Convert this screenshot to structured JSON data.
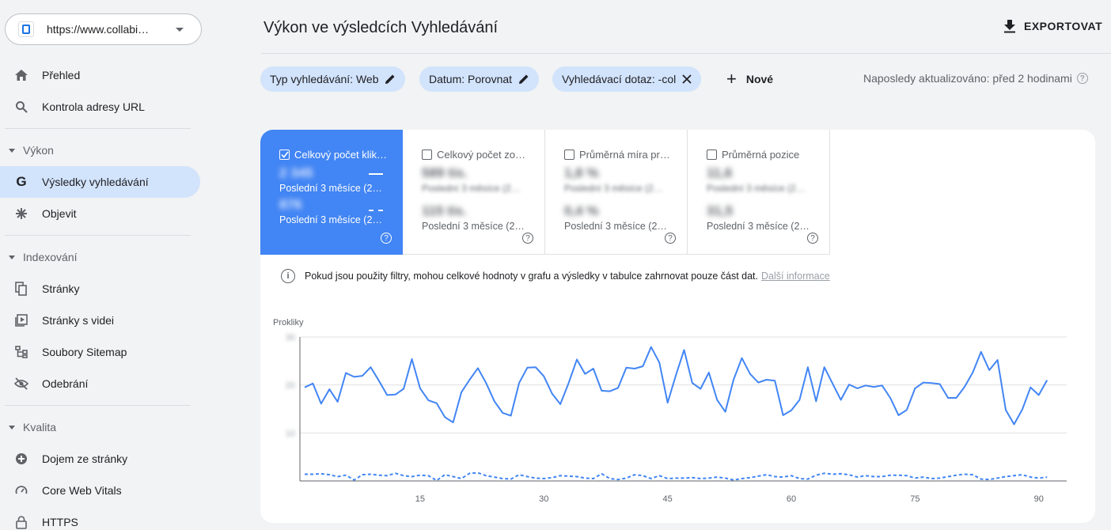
{
  "sidebar": {
    "property_url": "https://www.collabi…",
    "items_top": [
      {
        "label": "Přehled",
        "icon": "home-icon"
      },
      {
        "label": "Kontrola adresy URL",
        "icon": "search-icon"
      }
    ],
    "sections": [
      {
        "title": "Výkon",
        "items": [
          {
            "label": "Výsledky vyhledávání",
            "icon": "google-g-icon",
            "active": true
          },
          {
            "label": "Objevit",
            "icon": "asterisk-icon"
          }
        ]
      },
      {
        "title": "Indexování",
        "items": [
          {
            "label": "Stránky",
            "icon": "pages-icon"
          },
          {
            "label": "Stránky s videi",
            "icon": "video-pages-icon"
          },
          {
            "label": "Soubory Sitemap",
            "icon": "sitemap-icon"
          },
          {
            "label": "Odebrání",
            "icon": "eye-off-icon"
          }
        ]
      },
      {
        "title": "Kvalita",
        "items": [
          {
            "label": "Dojem ze stránky",
            "icon": "plus-circle-icon"
          },
          {
            "label": "Core Web Vitals",
            "icon": "gauge-icon"
          },
          {
            "label": "HTTPS",
            "icon": "lock-icon"
          }
        ]
      }
    ]
  },
  "header": {
    "title": "Výkon ve výsledcích Vyhledávání",
    "export_label": "EXPORTOVAT"
  },
  "filters": {
    "chips": [
      {
        "label": "Typ vyhledávání: Web",
        "icon": "pencil-icon"
      },
      {
        "label": "Datum: Porovnat",
        "icon": "pencil-icon"
      },
      {
        "label": "Vyhledávací dotaz: -col",
        "icon": "close-icon"
      }
    ],
    "new_label": "Nové",
    "updated_text": "Naposledy aktualizováno: před 2 hodinami"
  },
  "metrics": [
    {
      "label": "Celkový počet klik…",
      "checked": true,
      "value1": "2 345",
      "sub1": "",
      "period1": "Poslední 3 měsíce (2…",
      "value2": "876",
      "sub2": "",
      "period2": "Poslední 3 měsíce (2…"
    },
    {
      "label": "Celkový počet zo…",
      "checked": false,
      "value1": "589 tis.",
      "sub1": "Poslední 3 měsíce (2…",
      "value2": "115 tis.",
      "sub2": "",
      "period2": "Poslední 3 měsíce (2…"
    },
    {
      "label": "Průměrná míra pr…",
      "checked": false,
      "value1": "1,8 %",
      "sub1": "Poslední 3 měsíce (2…",
      "value2": "0,4 %",
      "sub2": "",
      "period2": "Poslední 3 měsíce (2…"
    },
    {
      "label": "Průměrná pozice",
      "checked": false,
      "value1": "11,6",
      "sub1": "Poslední 3 měsíce (2…",
      "value2": "31,5",
      "sub2": "",
      "period2": "Poslední 3 měsíce (2…"
    }
  ],
  "info": {
    "text": "Pokud jsou použity filtry, mohou celkové hodnoty v grafu a výsledky v tabulce zahrnovat pouze část dat.",
    "link": "Další informace"
  },
  "chart_data": {
    "type": "line",
    "ylabel": "Prokliky",
    "xlabel": "",
    "x_ticks": [
      15,
      30,
      45,
      60,
      75,
      90
    ],
    "xlim": [
      1,
      93
    ],
    "ylim": [
      0,
      30
    ],
    "y_ticks": [
      0,
      10,
      20,
      30
    ],
    "colors": {
      "current": "#4285f4",
      "previous": "#4285f4"
    },
    "series": [
      {
        "style": "solid",
        "values": [
          19.5,
          20.3,
          16.1,
          19.1,
          16.5,
          22.5,
          21.7,
          21.9,
          23.7,
          20.9,
          17.9,
          18.0,
          19.2,
          25.4,
          19.3,
          16.8,
          16.2,
          13.3,
          12.2,
          18.5,
          21.1,
          23.5,
          20.4,
          16.6,
          14.2,
          13.6,
          20.4,
          23.6,
          23.7,
          21.8,
          18.2,
          16.0,
          20.4,
          25.3,
          22.3,
          23.4,
          18.8,
          18.7,
          19.4,
          23.6,
          23.4,
          23.9,
          27.9,
          24.7,
          16.3,
          22.0,
          27.3,
          20.4,
          19.2,
          22.6,
          16.9,
          14.4,
          21.1,
          25.6,
          22.3,
          20.5,
          21.1,
          20.9,
          13.7,
          14.7,
          16.9,
          23.7,
          16.6,
          23.7,
          20.3,
          16.9,
          20.1,
          19.3,
          19.9,
          19.6,
          19.9,
          17.3,
          13.7,
          14.8,
          19.3,
          20.5,
          20.4,
          20.2,
          17.3,
          17.3,
          19.6,
          22.6,
          26.9,
          23.1,
          25.2,
          14.8,
          11.8,
          14.9,
          19.5,
          17.9,
          21.0
        ]
      },
      {
        "style": "dashed",
        "values": [
          1.4,
          1.4,
          1.5,
          1.3,
          0.9,
          1.2,
          0.2,
          1.3,
          1.4,
          1.2,
          1.1,
          1.6,
          1.1,
          0.9,
          1.2,
          1.1,
          0.1,
          1.3,
          0.9,
          0.5,
          1.6,
          1.7,
          1.1,
          0.8,
          0.5,
          0.4,
          1.3,
          0.9,
          0.6,
          0.5,
          0.7,
          1.1,
          1.0,
          0.9,
          0.6,
          0.5,
          1.5,
          0.5,
          0.3,
          0.6,
          1.3,
          1.1,
          0.5,
          1.1,
          0.5,
          0.6,
          0.6,
          0.7,
          0.5,
          0.6,
          0.8,
          0.6,
          0.2,
          0.5,
          0.7,
          1.0,
          1.3,
          0.9,
          0.8,
          1.1,
          0.5,
          0.4,
          1.2,
          1.6,
          1.4,
          1.5,
          1.3,
          0.8,
          1.1,
          0.9,
          0.9,
          1.2,
          1.2,
          1.1,
          0.6,
          0.8,
          0.5,
          0.6,
          0.9,
          1.2,
          1.4,
          1.3,
          0.4,
          0.3,
          0.6,
          0.9,
          1.1,
          1.3,
          0.8,
          0.6,
          0.8
        ]
      }
    ]
  }
}
